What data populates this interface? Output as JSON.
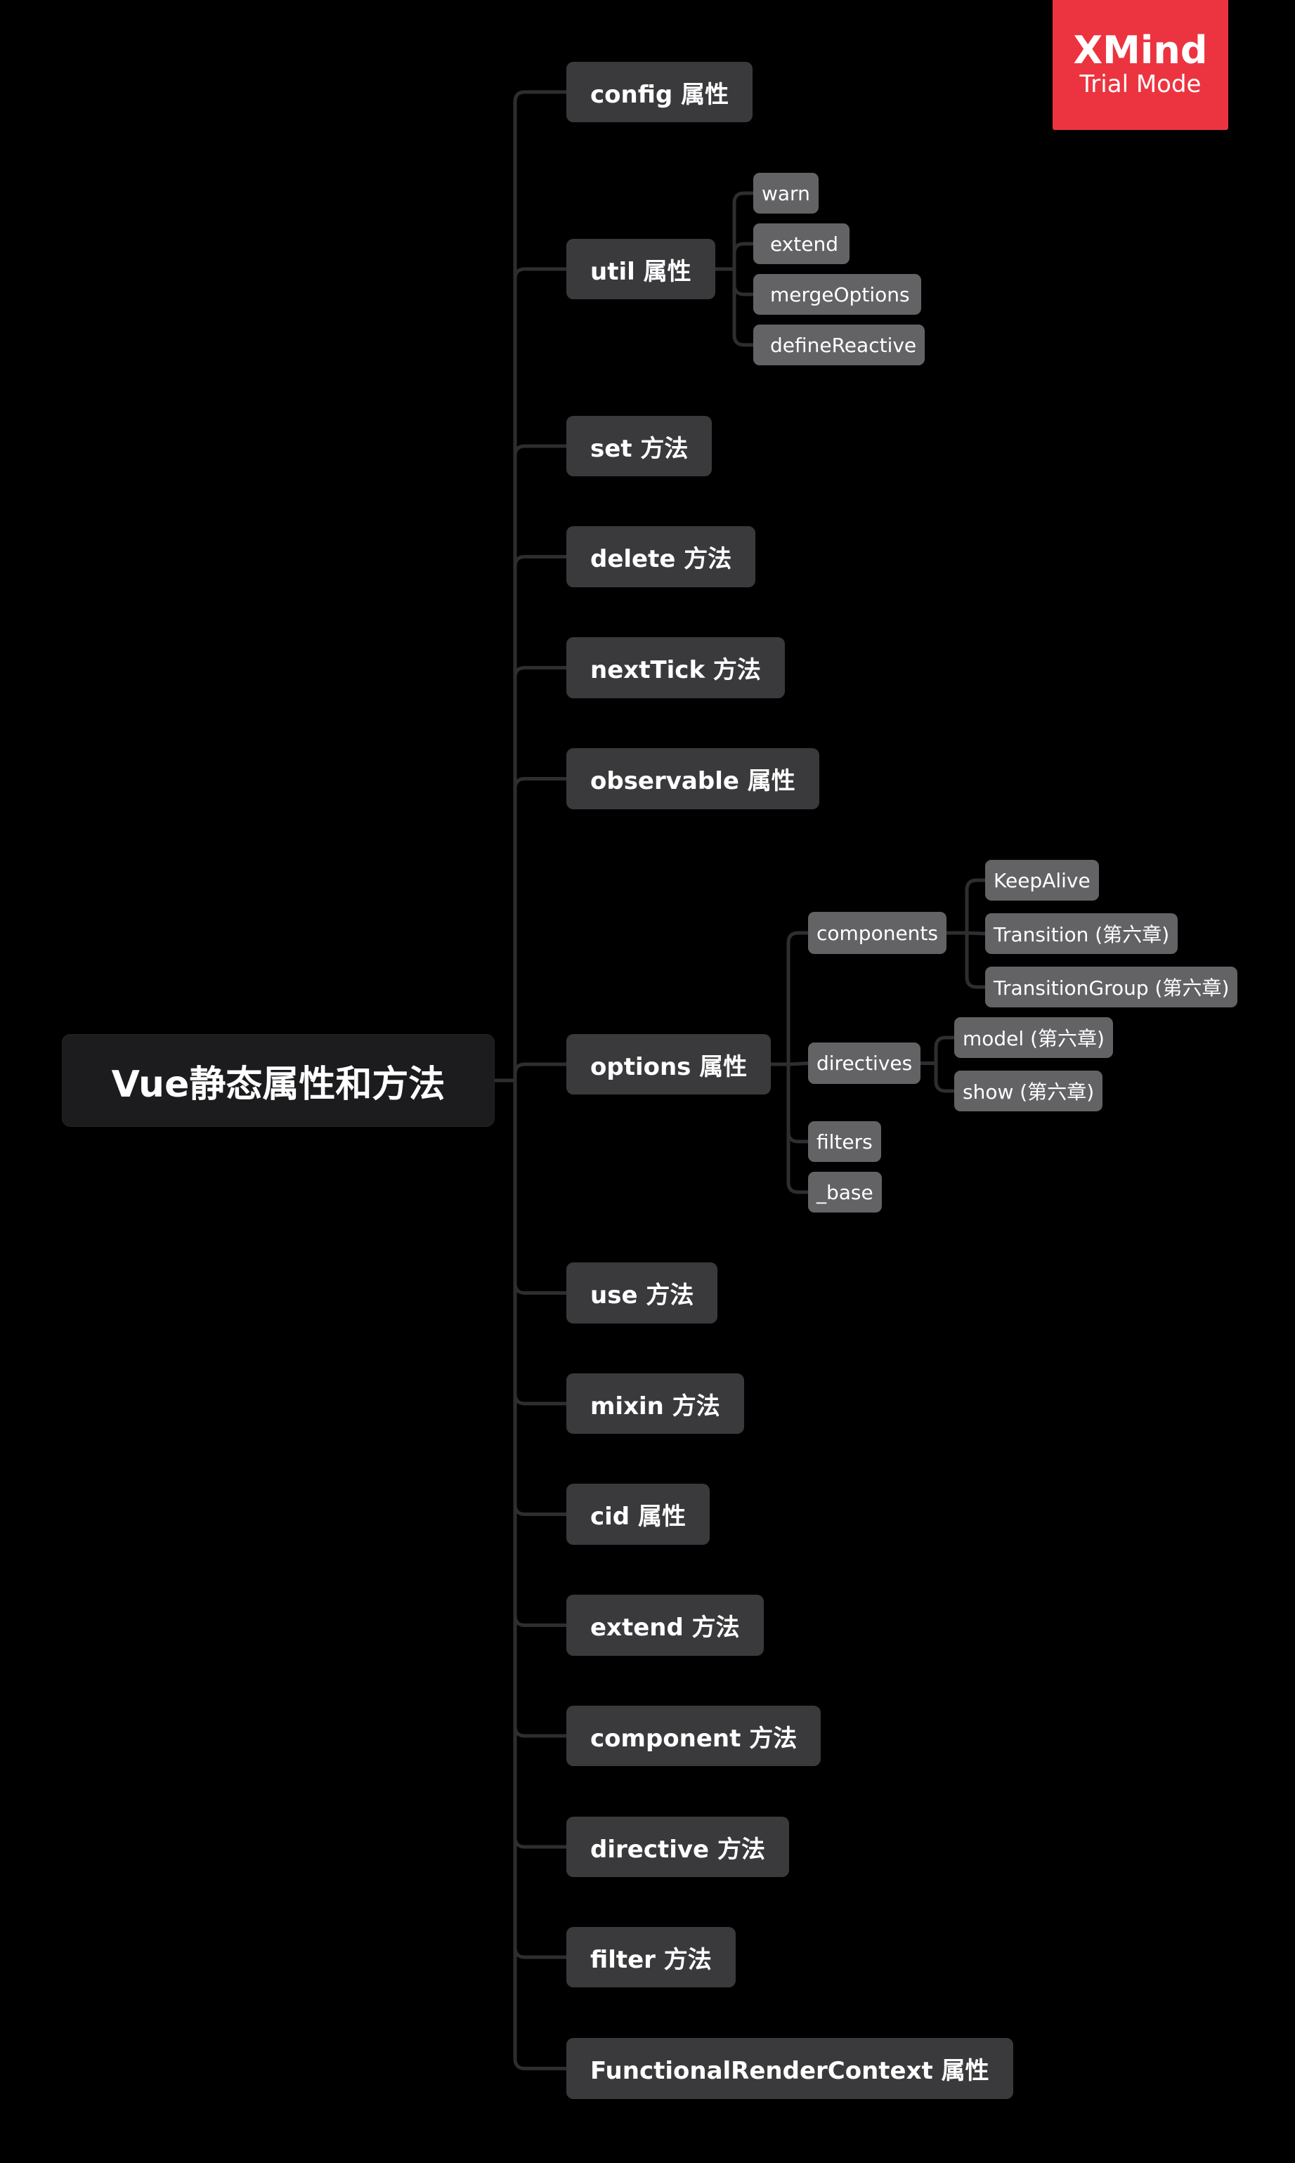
{
  "badge": {
    "brand": "XMind",
    "mode": "Trial Mode",
    "color": "#ec3440"
  },
  "colors": {
    "background": "#000000",
    "root_fill": "#1c1c1e",
    "level1_fill": "#3a3a3c",
    "level2_fill": "#636366",
    "connector": "#2e2e30"
  },
  "root": {
    "label": "Vue静态属性和方法"
  },
  "branches": [
    {
      "label": "config 属性"
    },
    {
      "label": "util 属性",
      "children": [
        {
          "label": "warn"
        },
        {
          "label": "extend"
        },
        {
          "label": "mergeOptions"
        },
        {
          "label": "defineReactive"
        }
      ]
    },
    {
      "label": "set 方法"
    },
    {
      "label": "delete 方法"
    },
    {
      "label": "nextTick 方法"
    },
    {
      "label": "observable 属性"
    },
    {
      "label": "options 属性",
      "children": [
        {
          "label": "components",
          "children": [
            {
              "label": "KeepAlive"
            },
            {
              "label": "Transition (第六章)"
            },
            {
              "label": "TransitionGroup (第六章)"
            }
          ]
        },
        {
          "label": "directives",
          "children": [
            {
              "label": "model (第六章)"
            },
            {
              "label": "show (第六章)"
            }
          ]
        },
        {
          "label": "filters"
        },
        {
          "label": "_base"
        }
      ]
    },
    {
      "label": "use 方法"
    },
    {
      "label": "mixin 方法"
    },
    {
      "label": "cid 属性"
    },
    {
      "label": "extend 方法"
    },
    {
      "label": "component 方法"
    },
    {
      "label": "directive 方法"
    },
    {
      "label": "filter 方法"
    },
    {
      "label": "FunctionalRenderContext 属性"
    }
  ]
}
